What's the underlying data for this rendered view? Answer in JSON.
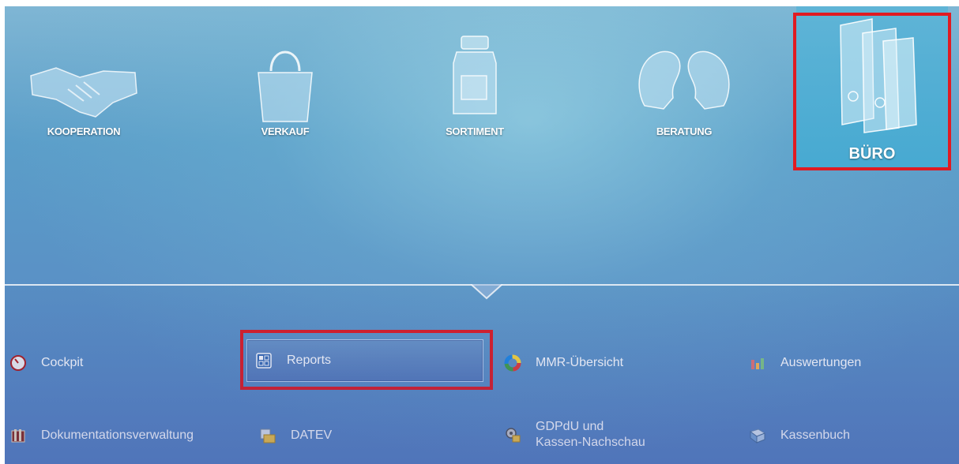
{
  "nav": {
    "tiles": [
      {
        "label": "KOOPERATION",
        "icon": "handshake-icon"
      },
      {
        "label": "VERKAUF",
        "icon": "shopping-bag-icon"
      },
      {
        "label": "SORTIMENT",
        "icon": "medicine-bottle-icon"
      },
      {
        "label": "BERATUNG",
        "icon": "consultation-heads-icon"
      },
      {
        "label": "BÜRO",
        "icon": "binders-icon",
        "active": true
      }
    ]
  },
  "submenu": {
    "items": [
      {
        "label": "Cockpit",
        "icon": "speedometer-icon"
      },
      {
        "label": "Reports",
        "icon": "reports-grid-icon",
        "selected": true
      },
      {
        "label": "MMR-Übersicht",
        "icon": "color-ring-icon"
      },
      {
        "label": "Auswertungen",
        "icon": "bar-chart-icon"
      },
      {
        "label": "Dokumentationsverwaltung",
        "icon": "document-archive-icon"
      },
      {
        "label": "DATEV",
        "icon": "datev-folder-icon"
      },
      {
        "label_line1": "GDPdU und",
        "label_line2": "Kassen-Nachschau",
        "icon": "audit-gear-icon"
      },
      {
        "label": "Kassenbuch",
        "icon": "cash-book-icon"
      }
    ]
  },
  "colors": {
    "highlight": "#e01b22",
    "text": "#ffffff"
  }
}
